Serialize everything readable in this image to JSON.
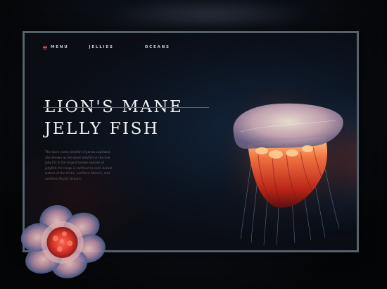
{
  "nav": {
    "menu_label": "MENU",
    "jellies_label": "JELLIES",
    "oceans_label": "OCEANS",
    "menu_icon": "hamburger-icon",
    "accent_color": "#d9534f"
  },
  "hero": {
    "title_line_1": "LION'S MANE",
    "title_line_2": "JELLY FISH",
    "description": "The lion's mane jellyfish (Cyanea capillata), also known as the giant jellyfish or the hair jelly,[1] is the largest known species of jellyfish. Its range is confined to cold, boreal waters of the Arctic, northern Atlantic, and northern Pacific Oceans."
  },
  "colors": {
    "background": "#050609",
    "frame_border": "#56616c",
    "title_text": "#f2f2f2",
    "strike_line": "#c0393a",
    "body_text": "#6d7380"
  }
}
